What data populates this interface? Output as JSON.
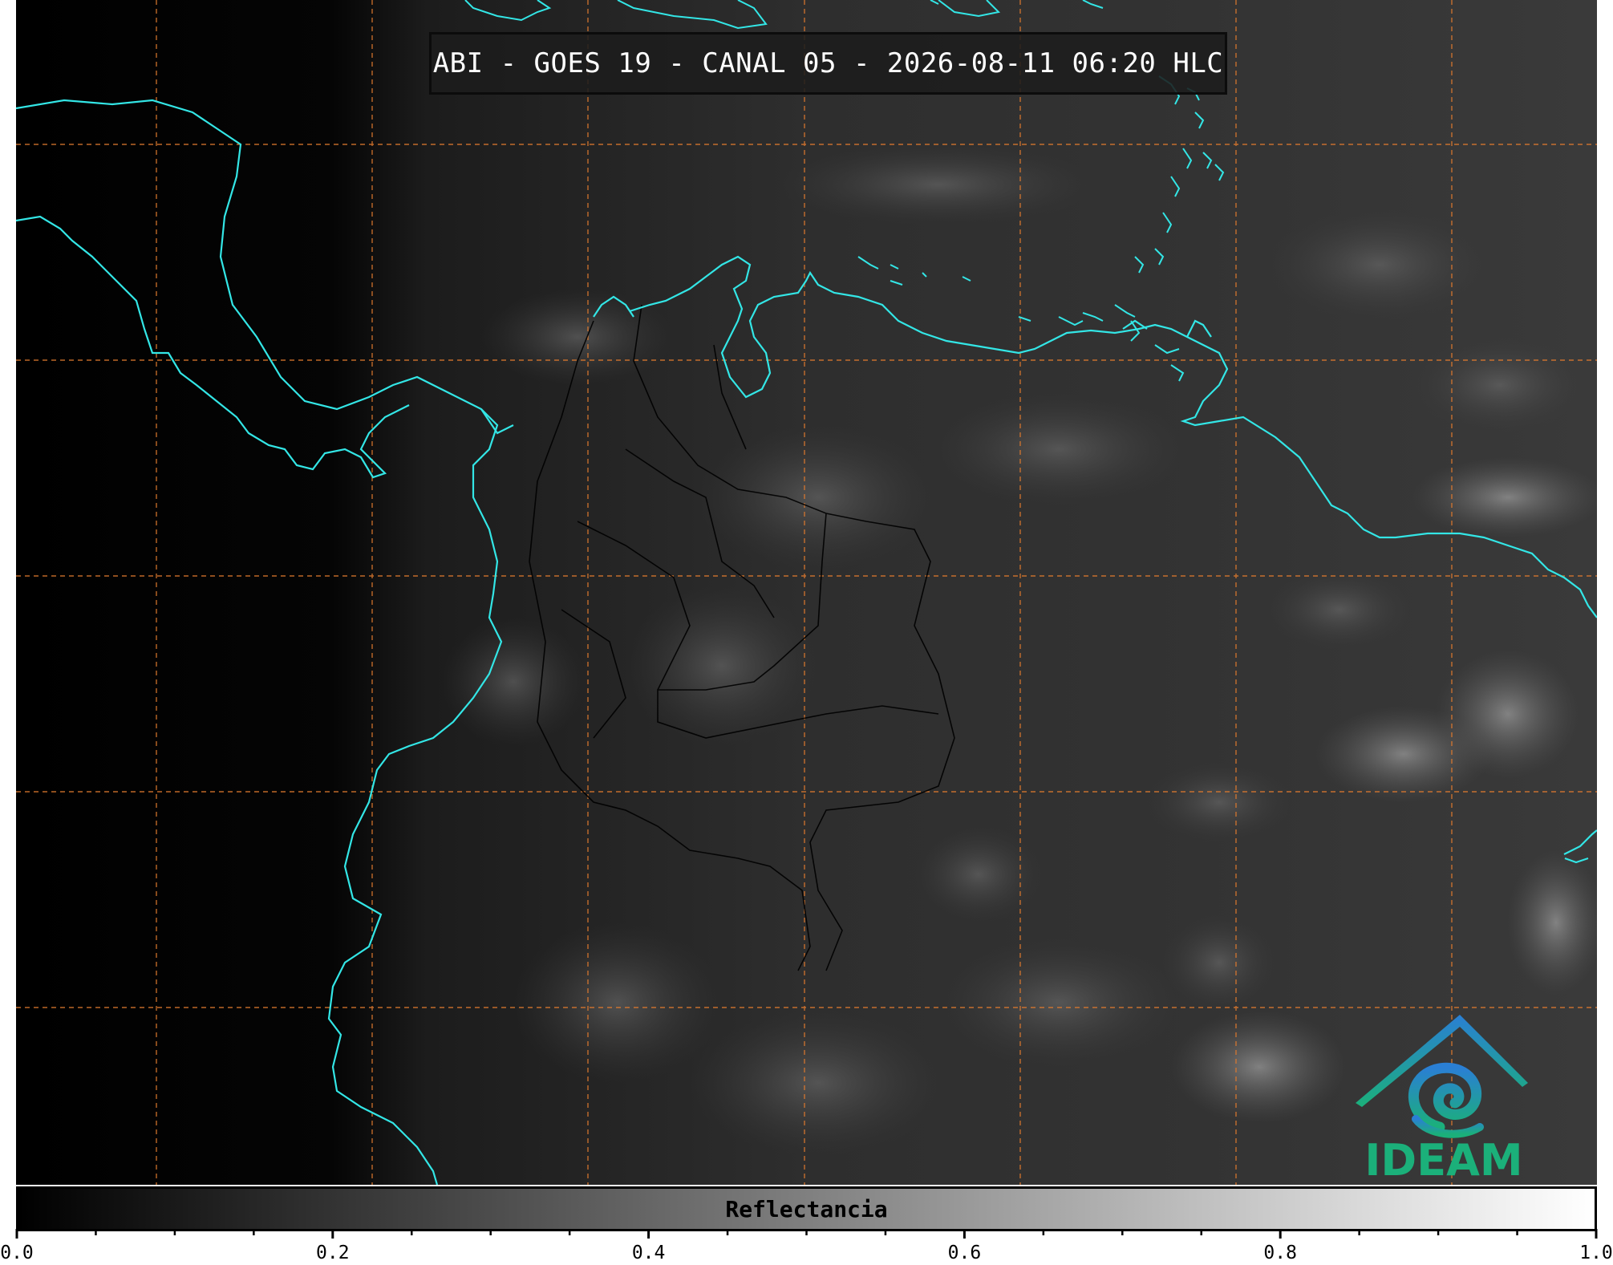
{
  "map": {
    "title": "ABI - GOES 19 - CANAL 05 - 2026-08-11 06:20 HLC",
    "coastline_color": "#33e6e6",
    "gridline_color": "#e07a2e",
    "border_color": "#000000",
    "background_color": "#000000"
  },
  "logo": {
    "text": "IDEAM",
    "icon": "ideam-mountain-swirl-icon",
    "colors": [
      "#2a7fd4",
      "#1bb07a"
    ]
  },
  "colorbar": {
    "label": "Reflectancia",
    "min": 0.0,
    "max": 1.0,
    "gradient": [
      "#000000",
      "#ffffff"
    ],
    "major_ticks": [
      "0.0",
      "0.2",
      "0.4",
      "0.6",
      "0.8",
      "1.0"
    ],
    "minor_per_major": 3
  }
}
